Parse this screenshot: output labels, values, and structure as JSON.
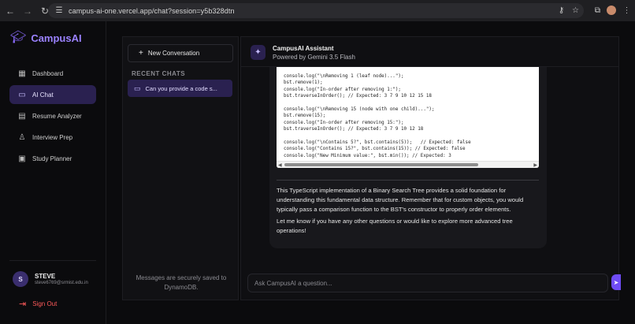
{
  "browser": {
    "url": "campus-ai-one.vercel.app/chat?session=y5b328dtn"
  },
  "sidebar": {
    "brand": "CampusAI",
    "items": [
      {
        "label": "Dashboard",
        "icon": "grid-icon"
      },
      {
        "label": "AI Chat",
        "icon": "chat-icon",
        "active": true
      },
      {
        "label": "Resume Analyzer",
        "icon": "document-icon"
      },
      {
        "label": "Interview Prep",
        "icon": "user-icon"
      },
      {
        "label": "Study Planner",
        "icon": "calendar-icon"
      }
    ],
    "user": {
      "initial": "S",
      "name": "STEVE",
      "email": "steve6769@srmist.edu.in"
    },
    "signout_label": "Sign Out"
  },
  "conversations": {
    "new_label": "New Conversation",
    "recent_label": "RECENT CHATS",
    "items": [
      {
        "label": "Can you provide a code s..."
      }
    ],
    "saved_note": "Messages are securely saved to DynamoDB."
  },
  "chat": {
    "title": "CampusAI Assistant",
    "subtitle": "Powered by Gemini 3.5 Flash",
    "code_lines": [
      "console.log(\"\\nRemoving 1 (leaf node)...\");",
      "bst.remove(1);",
      "console.log(\"In-order after removing 1:\");",
      "bst.traverseInOrder(); // Expected: 3 7 9 10 12 15 18",
      "",
      "console.log(\"\\nRemoving 15 (node with one child)...\");",
      "bst.remove(15);",
      "console.log(\"In-order after removing 15:\");",
      "bst.traverseInOrder(); // Expected: 3 7 9 10 12 18",
      "",
      "console.log(\"\\nContains 5?\", bst.contains(5));   // Expected: false",
      "console.log(\"Contains 15?\", bst.contains(15)); // Expected: false",
      "console.log(\"New Minimum value:\", bst.min()); // Expected: 3"
    ],
    "paragraph1": "This TypeScript implementation of a Binary Search Tree provides a solid foundation for understanding this fundamental data structure. Remember that for custom objects, you would typically pass a comparison function to the BST's constructor to properly order elements.",
    "paragraph2": "Let me know if you have any other questions or would like to explore more advanced tree operations!",
    "input_placeholder": "Ask CampusAI a question..."
  },
  "colors": {
    "accent": "#8b6cff",
    "active_bg": "#2a2150",
    "signout": "#ff5a5a"
  }
}
